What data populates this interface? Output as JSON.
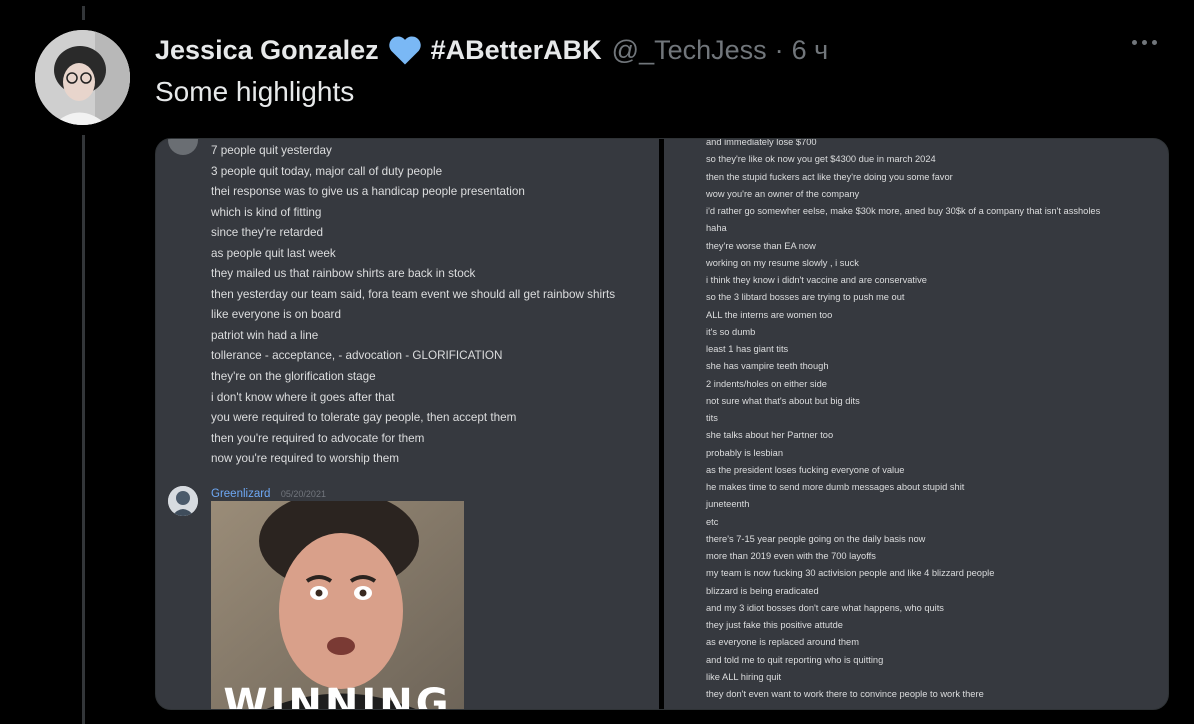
{
  "tweet": {
    "author_name": "Jessica Gonzalez",
    "hashtag": "#ABetterABK",
    "handle": "@_TechJess",
    "separator": "·",
    "time": "6 ч",
    "text": "Some highlights",
    "heart_color": "#7ab8f5"
  },
  "discord_left": {
    "lines": [
      "7 people quit yesterday",
      "3 people quit today, major call of duty people",
      "thei response was to give us a handicap people presentation",
      "which is kind of fitting",
      "since they're retarded",
      "as people quit last week",
      "they mailed us that rainbow shirts are back in stock",
      "then yesterday our team said, fora  team event we should all get rainbow shirts",
      "like everyone is on board",
      "patriot win had a line",
      "tollerance - acceptance, - advocation - GLORIFICATION",
      "they're on the glorification stage",
      "i don't know where it goes after that",
      "you were required to tolerate gay people, then accept them",
      "then you're required to advocate for them",
      "now you're required to worship them"
    ],
    "next_message": {
      "username": "Greenlizard",
      "date": "05/20/2021",
      "image_caption": "WINNING"
    }
  },
  "discord_right": {
    "lines": [
      "and immediately lose $700",
      "so they're like ok now you get $4300 due in march 2024",
      "then the stupid fuckers act like they're doing you some favor",
      "wow you're an owner of the company",
      "i'd rather go somewher eelse, make $30k more, aned buy 30$k of a company that isn't assholes",
      "haha",
      "they're worse than EA now",
      "working on my resume slowly , i suck",
      "i think they know i didn't vaccine and are conservative",
      "so the 3 libtard bosses are trying to push me out",
      "ALL the interns are women too",
      "it's so dumb",
      "least 1 has giant tits",
      "she has vampire teeth though",
      "2 indents/holes on either side",
      "not sure what that's about but big dits",
      "tits",
      "she talks about her Partner too",
      "probably is lesbian",
      "as the president loses fucking everyone of value",
      "he makes time to send more dumb messages about stupid shit",
      "juneteenth",
      "etc",
      "there's 7-15 year people going on the daily basis now",
      "more than 2019 even with the 700 layoffs",
      "my team is now fucking 30 activision people and like 4 blizzard people",
      "blizzard is being eradicated",
      "and my 3 idiot bosses don't care what happens, who quits",
      "they just fake this positive attutde",
      "as everyone is replaced around them",
      "and told me to quit reporting who is quitting",
      "like ALL hiring quit",
      "they don't even want to work there to convince people to work there"
    ]
  }
}
